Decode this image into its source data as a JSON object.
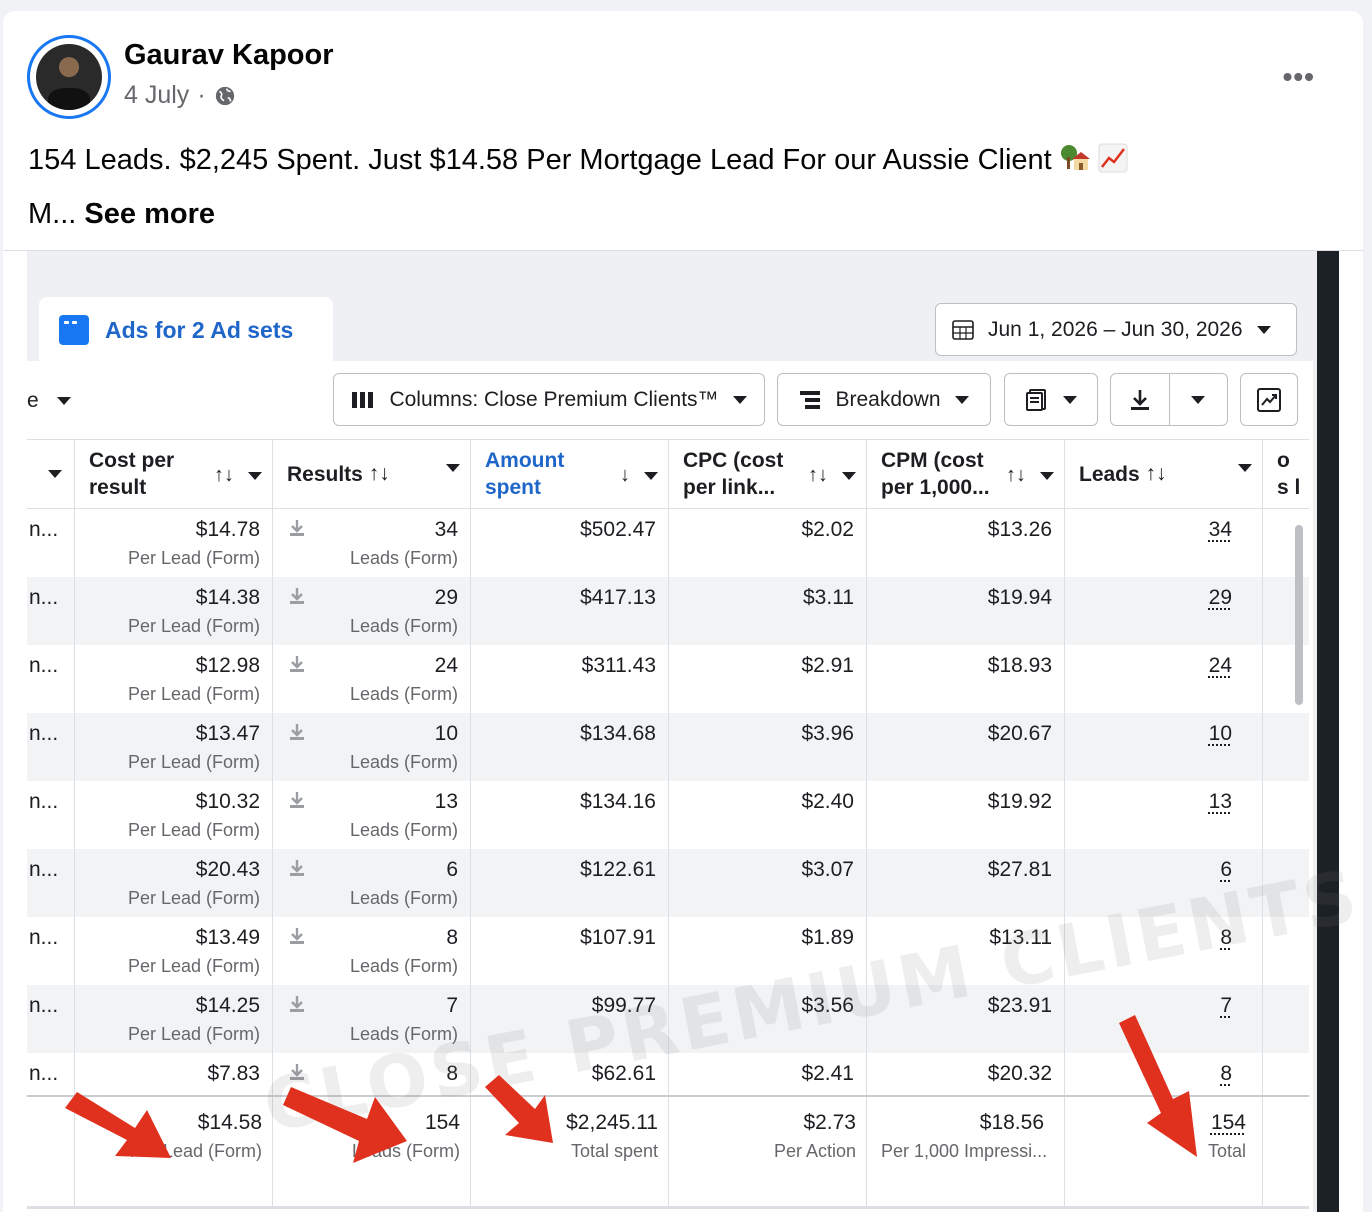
{
  "post": {
    "author": "Gaurav Kapoor",
    "date": "4 July",
    "separator": "·",
    "privacy_icon": "globe-icon",
    "more_icon": "more-dots-icon",
    "more_label": "•••",
    "line1": "154 Leads. $2,245 Spent. Just $14.58 Per Mortgage Lead For our Aussie Client",
    "line2_prefix": "M...",
    "see_more": "See more",
    "emojis": [
      "house-with-tree-emoji",
      "chart-increasing-emoji"
    ]
  },
  "ads_manager": {
    "tab_label": "Ads for 2 Ad sets",
    "date_range": "Jun 1, 2026 – Jun 30, 2026",
    "left_partial": "e",
    "columns_label": "Columns: Close Premium Clients™",
    "breakdown_label": "Breakdown",
    "watermark": "CLOSE PREMIUM CLIENTS"
  },
  "table": {
    "headers": {
      "cost_per_result": "Cost per result",
      "results": "Results",
      "amount_spent": "Amount spent",
      "cpc": "CPC (cost per link...",
      "cpm": "CPM (cost per 1,000...",
      "leads": "Leads",
      "partial": "Cos lea"
    },
    "sort_icon": "↑↓",
    "sort_down_icon": "↓",
    "rows": [
      {
        "name": "n...",
        "cost": "$14.78",
        "cost_sub": "Per Lead (Form)",
        "results": "34",
        "results_sub": "Leads (Form)",
        "amount": "$502.47",
        "cpc": "$2.02",
        "cpm": "$13.26",
        "leads": "34"
      },
      {
        "name": "n...",
        "cost": "$14.38",
        "cost_sub": "Per Lead (Form)",
        "results": "29",
        "results_sub": "Leads (Form)",
        "amount": "$417.13",
        "cpc": "$3.11",
        "cpm": "$19.94",
        "leads": "29"
      },
      {
        "name": "n...",
        "cost": "$12.98",
        "cost_sub": "Per Lead (Form)",
        "results": "24",
        "results_sub": "Leads (Form)",
        "amount": "$311.43",
        "cpc": "$2.91",
        "cpm": "$18.93",
        "leads": "24"
      },
      {
        "name": "n...",
        "cost": "$13.47",
        "cost_sub": "Per Lead (Form)",
        "results": "10",
        "results_sub": "Leads (Form)",
        "amount": "$134.68",
        "cpc": "$3.96",
        "cpm": "$20.67",
        "leads": "10"
      },
      {
        "name": "n...",
        "cost": "$10.32",
        "cost_sub": "Per Lead (Form)",
        "results": "13",
        "results_sub": "Leads (Form)",
        "amount": "$134.16",
        "cpc": "$2.40",
        "cpm": "$19.92",
        "leads": "13"
      },
      {
        "name": "n...",
        "cost": "$20.43",
        "cost_sub": "Per Lead (Form)",
        "results": "6",
        "results_sub": "Leads (Form)",
        "amount": "$122.61",
        "cpc": "$3.07",
        "cpm": "$27.81",
        "leads": "6"
      },
      {
        "name": "n...",
        "cost": "$13.49",
        "cost_sub": "Per Lead (Form)",
        "results": "8",
        "results_sub": "Leads (Form)",
        "amount": "$107.91",
        "cpc": "$1.89",
        "cpm": "$13.11",
        "leads": "8"
      },
      {
        "name": "n...",
        "cost": "$14.25",
        "cost_sub": "Per Lead (Form)",
        "results": "7",
        "results_sub": "Leads (Form)",
        "amount": "$99.77",
        "cpc": "$3.56",
        "cpm": "$23.91",
        "leads": "7"
      },
      {
        "name": "n...",
        "cost": "$7.83",
        "cost_sub": "",
        "results": "8",
        "results_sub": "",
        "amount": "$62.61",
        "cpc": "$2.41",
        "cpm": "$20.32",
        "leads": "8"
      }
    ],
    "totals": {
      "cost": "$14.58",
      "cost_sub": "Per Lead (Form)",
      "results": "154",
      "results_sub": "Leads (Form)",
      "amount": "$2,245.11",
      "amount_sub": "Total spent",
      "cpc": "$2.73",
      "cpc_sub": "Per Action",
      "cpm": "$18.56",
      "cpm_sub": "Per 1,000 Impressi...",
      "leads": "154",
      "leads_sub": "Total"
    }
  },
  "colors": {
    "accent": "#1877f2",
    "link_blue": "#1f66c9",
    "arrow_red": "#e0301e"
  }
}
